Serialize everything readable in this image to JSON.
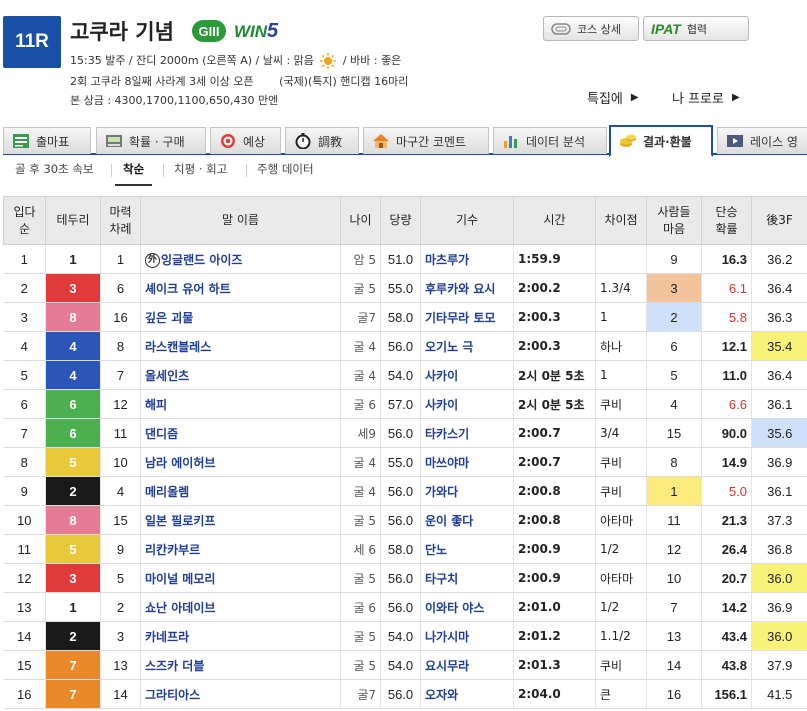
{
  "header": {
    "race_no": "11R",
    "race_name": "고쿠라 기념",
    "grade": "GIII",
    "win5": {
      "prefix": "WIN",
      "digit": "5"
    },
    "line1_a": "15:35 발주 / 잔디 2000m (오른쪽 A) / 날씨 : 맑음",
    "line1_b": "/ 바바 : 좋은",
    "line2_a": "2회 고쿠라 8일째 사라계 3세 이상 오픈",
    "line2_b": "(국제)(특지) 핸디캡 16마리",
    "line3": "본 상금 : 4300,1700,1100,650,430 만엔",
    "course_btn": "코스 상세",
    "ipat_logo": "IPAT",
    "ipat_btn": "협력",
    "special_link": "특집에",
    "next_link": "나 프로로"
  },
  "tabs": [
    {
      "label": "출마표",
      "icon": "entry-table-icon"
    },
    {
      "label": "확률 · 구매",
      "icon": "odds-icon"
    },
    {
      "label": "예상",
      "icon": "target-icon"
    },
    {
      "label": "調教",
      "icon": "stopwatch-icon"
    },
    {
      "label": "마구간 코멘트",
      "icon": "stable-icon"
    },
    {
      "label": "데이터 분석",
      "icon": "bar-chart-icon"
    },
    {
      "label": "결과·환불",
      "icon": "coins-icon",
      "active": true
    },
    {
      "label": "레이스 영",
      "icon": "video-icon"
    }
  ],
  "subtabs": [
    "골 후 30초 속보",
    "착순",
    "치평 · 회고",
    "주행 데이터"
  ],
  "columns": [
    "입다\n순",
    "테두리",
    "마력\n차례",
    "말 이름",
    "나이",
    "당량",
    "기수",
    "시간",
    "차이점",
    "사람들\n마음",
    "단승\n확률",
    "後3F"
  ],
  "colors": {
    "gate1": "#ffffff",
    "gate2": "#1a1a1a",
    "gate3": "#e03a3a",
    "gate4": "#2c55b8",
    "gate5": "#e9c93a",
    "gate6": "#4caf50",
    "gate7": "#e9892a",
    "gate8": "#e57b94",
    "accent": "#1a4fa8"
  },
  "rows": [
    {
      "pos": "1",
      "gate": "1",
      "num": "1",
      "horse": "잉글랜드 아이즈",
      "foreign": "外",
      "age": "암 5",
      "weight": "51.0",
      "jockey": "마츠루가",
      "time": "1:59.9",
      "margin": "",
      "pop": "9",
      "odds": "16.3",
      "last3f": "36.2"
    },
    {
      "pos": "2",
      "gate": "3",
      "num": "6",
      "horse": "셰이크 유어 하트",
      "age": "굴 5",
      "weight": "55.0",
      "jockey": "후루카와 요시",
      "time": "2:00.2",
      "margin": "1.3/4",
      "pop": "3",
      "odds": "6.1",
      "last3f": "36.4"
    },
    {
      "pos": "3",
      "gate": "8",
      "num": "16",
      "horse": "깊은 괴물",
      "age": "굴7",
      "weight": "58.0",
      "jockey": "기타무라 토모",
      "time": "2:00.3",
      "margin": "1",
      "pop": "2",
      "odds": "5.8",
      "last3f": "36.3"
    },
    {
      "pos": "4",
      "gate": "4",
      "num": "8",
      "horse": "라스캔블레스",
      "age": "굴 4",
      "weight": "56.0",
      "jockey": "오기노 극",
      "time": "2:00.3",
      "margin": "하나",
      "pop": "6",
      "odds": "12.1",
      "last3f": "35.4"
    },
    {
      "pos": "5",
      "gate": "4",
      "num": "7",
      "horse": "올세인츠",
      "age": "굴 4",
      "weight": "54.0",
      "jockey": "사카이",
      "time": "2시 0분 5초",
      "margin": "1",
      "pop": "5",
      "odds": "11.0",
      "last3f": "36.4"
    },
    {
      "pos": "6",
      "gate": "6",
      "num": "12",
      "horse": "해피",
      "age": "굴 6",
      "weight": "57.0",
      "jockey": "사카이",
      "time": "2시 0분 5초",
      "margin": "쿠비",
      "pop": "4",
      "odds": "6.6",
      "last3f": "36.1"
    },
    {
      "pos": "7",
      "gate": "6",
      "num": "11",
      "horse": "댄디즘",
      "age": "세9",
      "weight": "56.0",
      "jockey": "타카스기",
      "time": "2:00.7",
      "margin": "3/4",
      "pop": "15",
      "odds": "90.0",
      "last3f": "35.6"
    },
    {
      "pos": "8",
      "gate": "5",
      "num": "10",
      "horse": "남라 에이허브",
      "age": "굴 4",
      "weight": "55.0",
      "jockey": "마쓰야마",
      "time": "2:00.7",
      "margin": "쿠비",
      "pop": "8",
      "odds": "14.9",
      "last3f": "36.9"
    },
    {
      "pos": "9",
      "gate": "2",
      "num": "4",
      "horse": "메리올렘",
      "age": "굴 4",
      "weight": "56.0",
      "jockey": "가와다",
      "time": "2:00.8",
      "margin": "쿠비",
      "pop": "1",
      "odds": "5.0",
      "last3f": "36.1"
    },
    {
      "pos": "10",
      "gate": "8",
      "num": "15",
      "horse": "일본 필로키프",
      "age": "굴 5",
      "weight": "56.0",
      "jockey": "운이 좋다",
      "time": "2:00.8",
      "margin": "아타마",
      "pop": "11",
      "odds": "21.3",
      "last3f": "37.3"
    },
    {
      "pos": "11",
      "gate": "5",
      "num": "9",
      "horse": "리칸카부르",
      "age": "세 6",
      "weight": "58.0",
      "jockey": "단노",
      "time": "2:00.9",
      "margin": "1/2",
      "pop": "12",
      "odds": "26.4",
      "last3f": "36.8"
    },
    {
      "pos": "12",
      "gate": "3",
      "num": "5",
      "horse": "마이널 메모리",
      "age": "굴 5",
      "weight": "56.0",
      "jockey": "타구치",
      "time": "2:00.9",
      "margin": "아타마",
      "pop": "10",
      "odds": "20.7",
      "last3f": "36.0"
    },
    {
      "pos": "13",
      "gate": "1",
      "num": "2",
      "horse": "쇼난 아데이브",
      "age": "굴 6",
      "weight": "56.0",
      "jockey": "이와타 야스",
      "time": "2:01.0",
      "margin": "1/2",
      "pop": "7",
      "odds": "14.2",
      "last3f": "36.9"
    },
    {
      "pos": "14",
      "gate": "2",
      "num": "3",
      "horse": "카네프라",
      "age": "굴 5",
      "weight": "54.0",
      "jockey": "나가시마",
      "time": "2:01.2",
      "margin": "1.1/2",
      "pop": "13",
      "odds": "43.4",
      "last3f": "36.0"
    },
    {
      "pos": "15",
      "gate": "7",
      "num": "13",
      "horse": "스즈카 더블",
      "age": "굴 5",
      "weight": "54.0",
      "jockey": "요시무라",
      "time": "2:01.3",
      "margin": "쿠비",
      "pop": "14",
      "odds": "43.8",
      "last3f": "37.9"
    },
    {
      "pos": "16",
      "gate": "7",
      "num": "14",
      "horse": "그라티아스",
      "age": "굴7",
      "weight": "56.0",
      "jockey": "오자와",
      "time": "2:04.0",
      "margin": "큰",
      "pop": "16",
      "odds": "156.1",
      "last3f": "41.5"
    }
  ]
}
